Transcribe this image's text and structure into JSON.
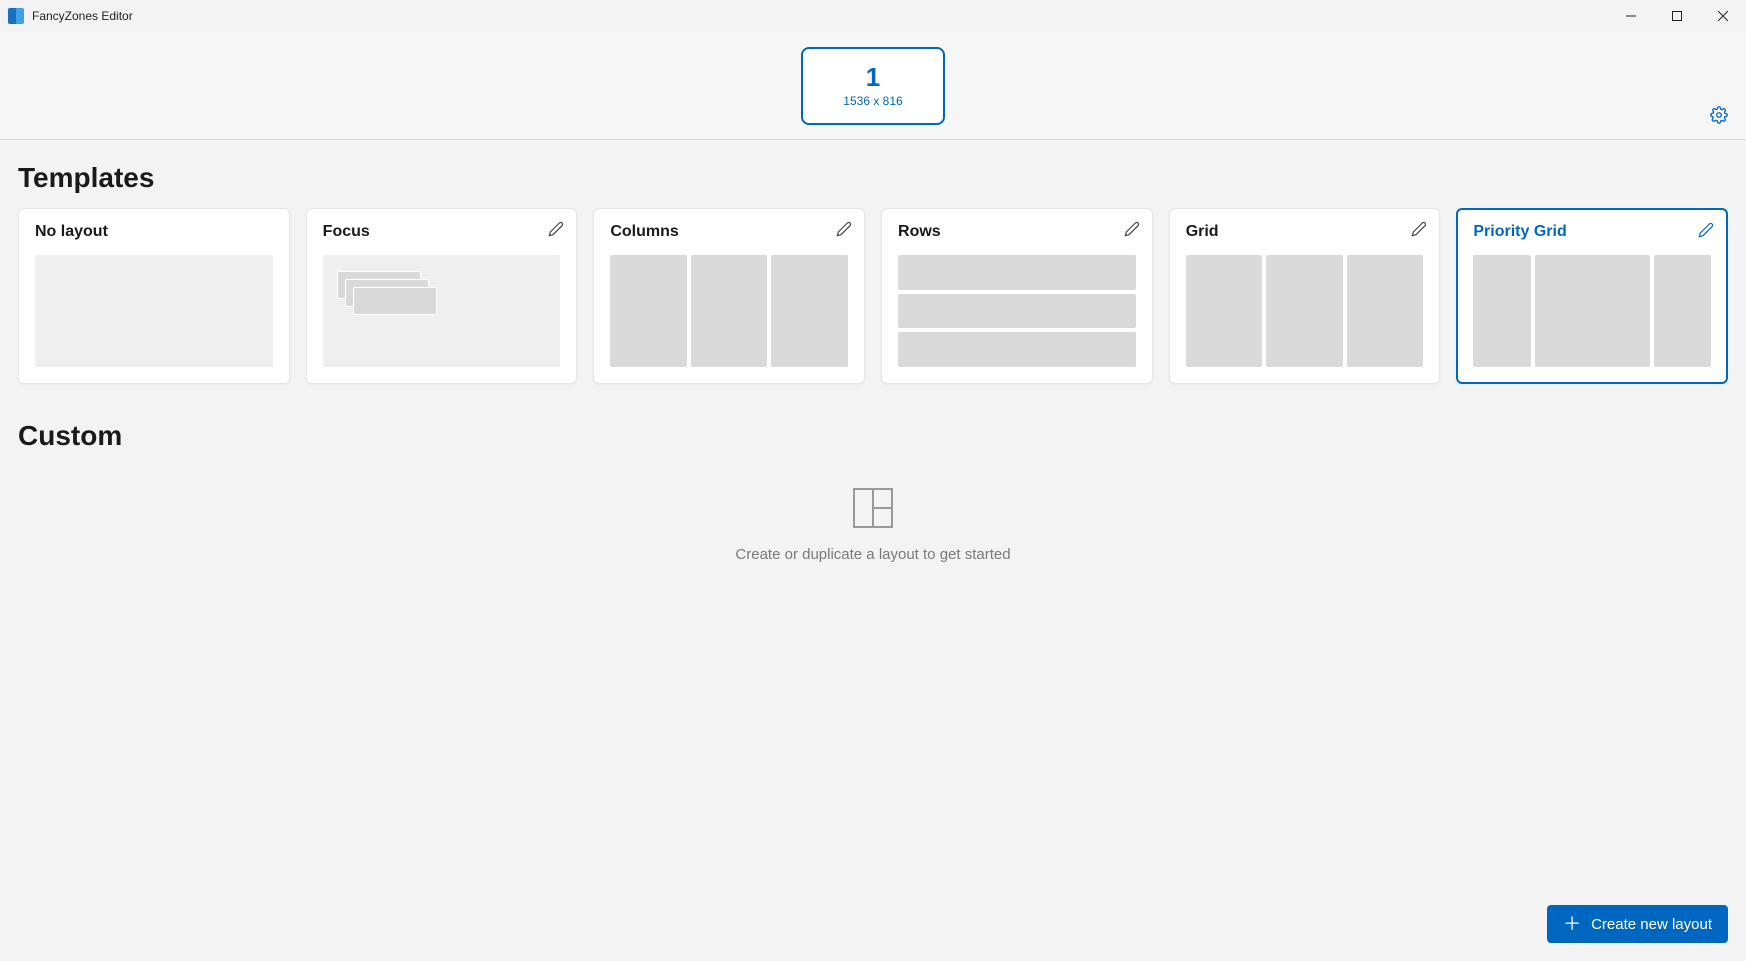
{
  "window": {
    "title": "FancyZones Editor"
  },
  "monitor": {
    "number": "1",
    "resolution": "1536 x 816"
  },
  "sections": {
    "templates": "Templates",
    "custom": "Custom"
  },
  "templates": [
    {
      "id": "no-layout",
      "label": "No layout",
      "editable": false,
      "selected": false
    },
    {
      "id": "focus",
      "label": "Focus",
      "editable": true,
      "selected": false
    },
    {
      "id": "columns",
      "label": "Columns",
      "editable": true,
      "selected": false
    },
    {
      "id": "rows",
      "label": "Rows",
      "editable": true,
      "selected": false
    },
    {
      "id": "grid",
      "label": "Grid",
      "editable": true,
      "selected": false
    },
    {
      "id": "priority",
      "label": "Priority Grid",
      "editable": true,
      "selected": true
    }
  ],
  "empty_state": {
    "text": "Create or duplicate a layout to get started"
  },
  "buttons": {
    "create_new_layout": "Create new layout"
  }
}
